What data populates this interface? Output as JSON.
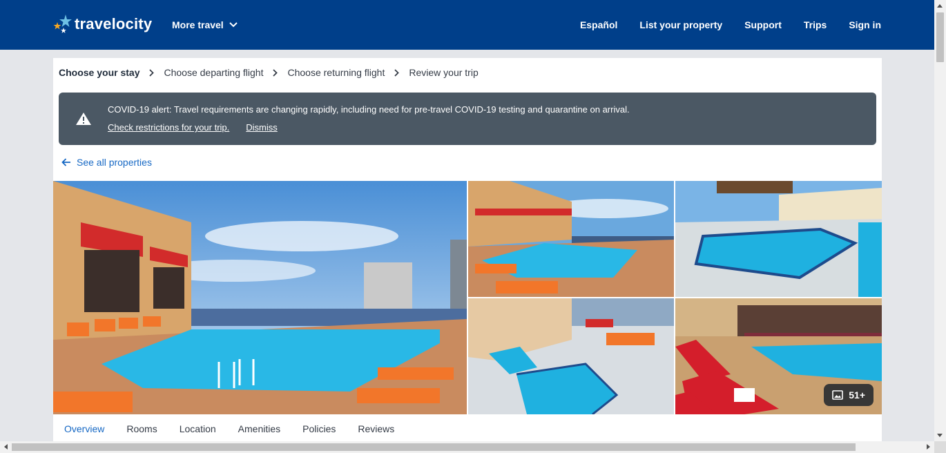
{
  "header": {
    "logo_text": "travelocity",
    "more_travel": "More travel",
    "nav": [
      "Español",
      "List your property",
      "Support",
      "Trips",
      "Sign in"
    ]
  },
  "breadcrumb": {
    "steps": [
      "Choose your stay",
      "Choose departing flight",
      "Choose returning flight",
      "Review your trip"
    ],
    "active_index": 0
  },
  "alert": {
    "message": "COVID-19 alert: Travel requirements are changing rapidly, including need for pre-travel COVID-19 testing and quarantine on arrival.",
    "check_link": "Check restrictions for your trip.",
    "dismiss_link": "Dismiss"
  },
  "back_link": "See all properties",
  "gallery": {
    "photo_count": "51+"
  },
  "tabs": [
    "Overview",
    "Rooms",
    "Location",
    "Amenities",
    "Policies",
    "Reviews"
  ],
  "colors": {
    "header_bg": "#003f8a",
    "alert_bg": "#4b5864",
    "link": "#1668c4"
  }
}
